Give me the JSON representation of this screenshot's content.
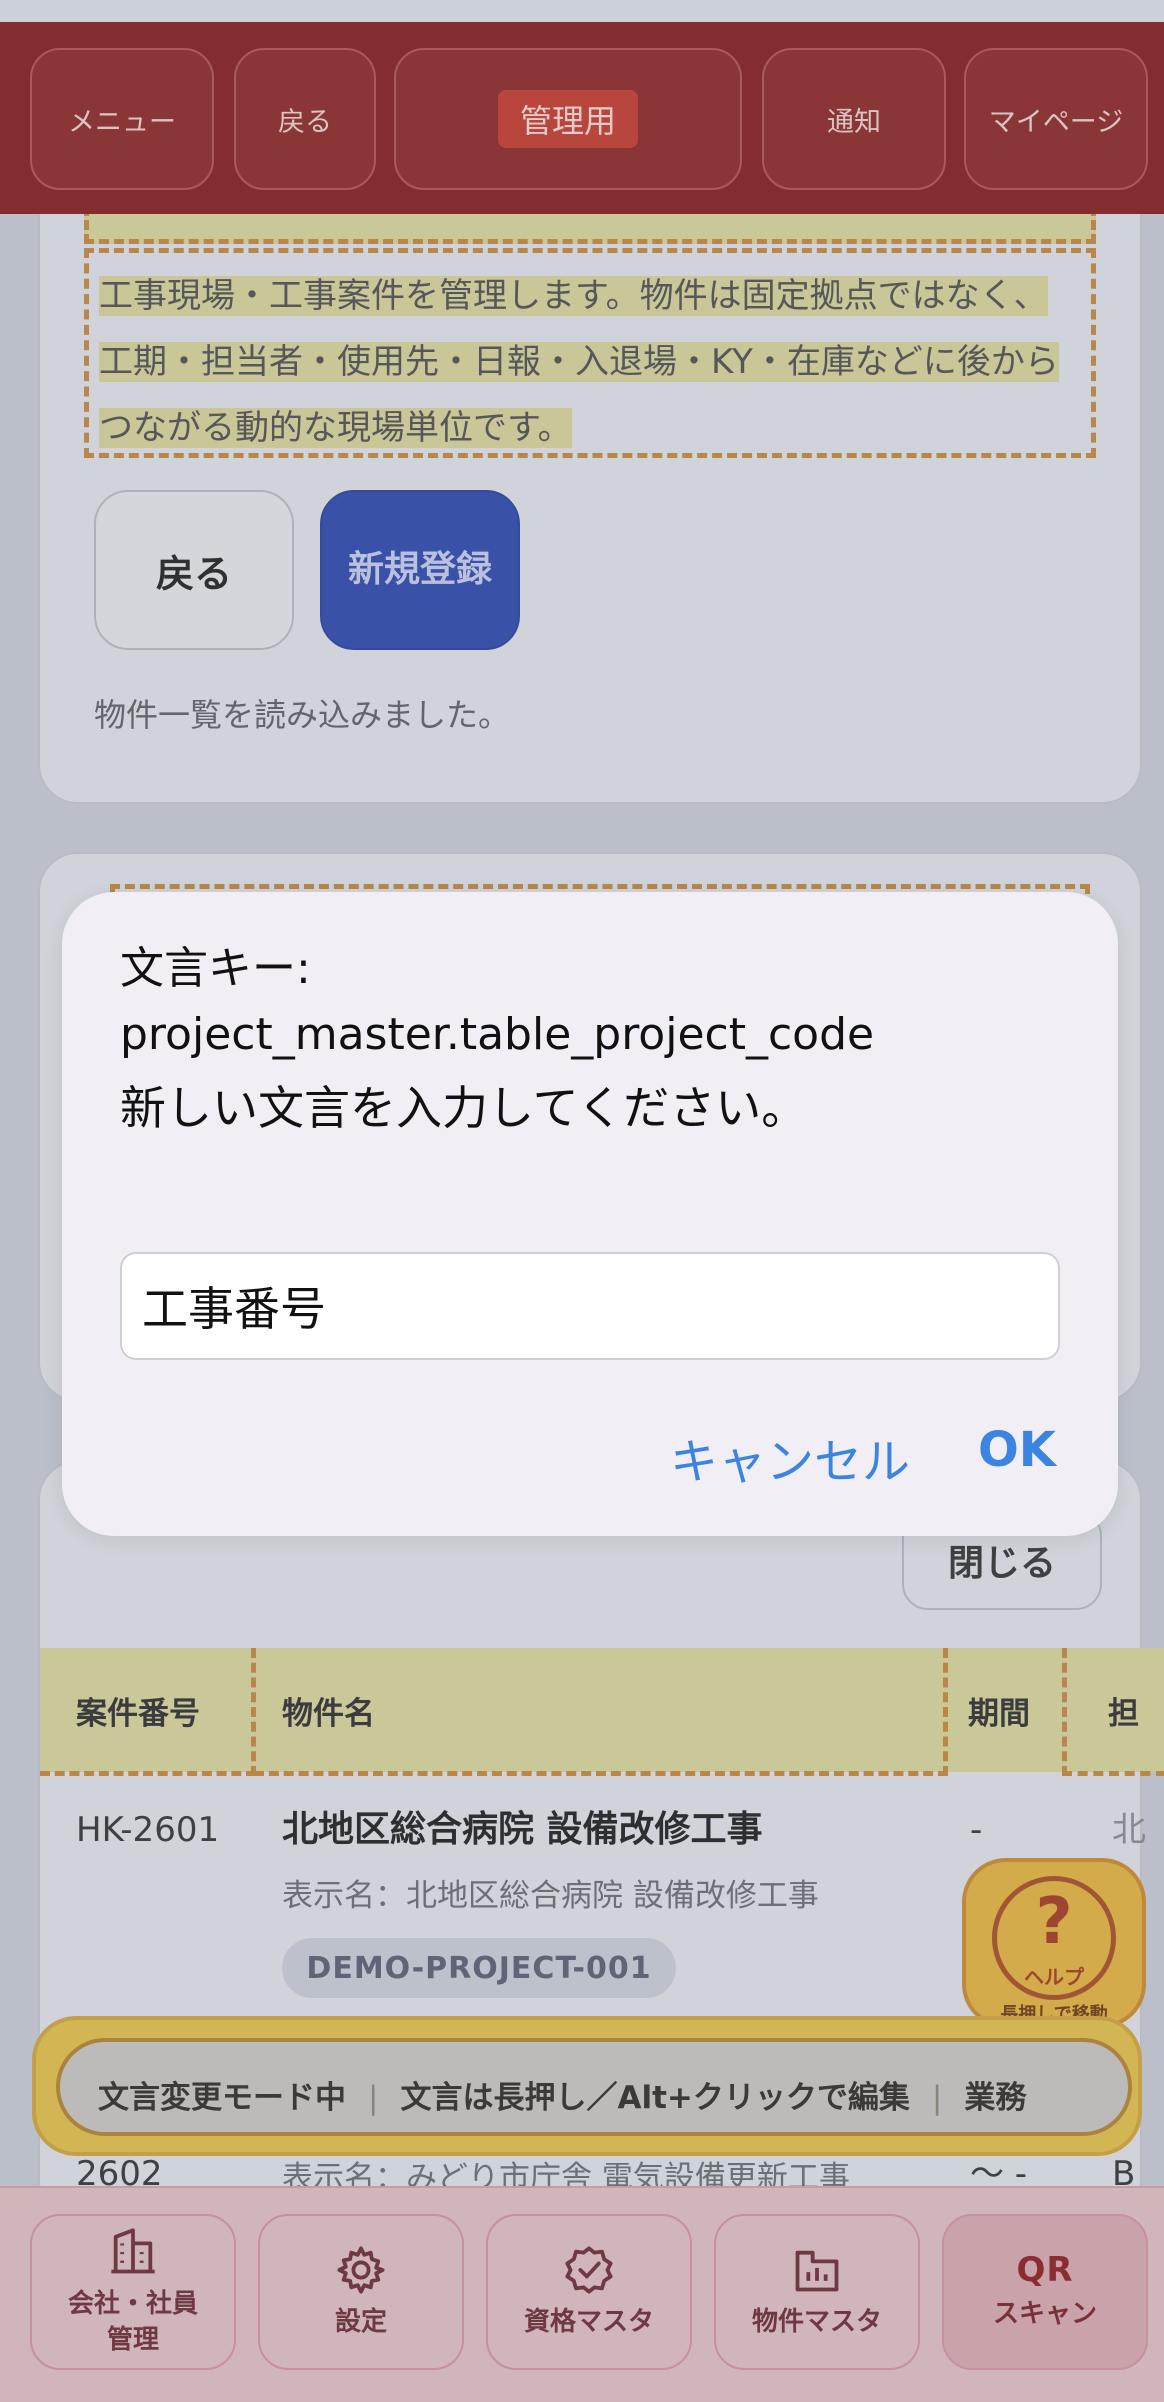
{
  "header": {
    "menu_label": "メニュー",
    "back_label": "戻る",
    "admin_label": "管理用",
    "notify_label": "通知",
    "mypage_label": "マイページ"
  },
  "intro": {
    "description": "工事現場・工事案件を管理します。物件は固定拠点ではなく、工期・担当者・使用先・日報・入退場・KY・在庫などに後からつながる動的な現場単位です。",
    "back_button": "戻る",
    "new_button": "新規登録",
    "status": "物件一覧を読み込みました。"
  },
  "list": {
    "close_button": "閉じる",
    "columns": [
      "案件番号",
      "物件名",
      "期間",
      "担"
    ],
    "rows": [
      {
        "code": "HK-2601",
        "name": "北地区総合病院 設備改修工事",
        "display_name": "表示名：北地区総合病院 設備改修工事",
        "badge": "DEMO-PROJECT-001",
        "period": "-",
        "owner": "北"
      },
      {
        "code": "2602",
        "display_name": "表示名：みどり市庁舎 電気設備更新工事",
        "period": "〜 -",
        "owner": "B"
      }
    ]
  },
  "help": {
    "label": "ヘルプ",
    "sub": "長押しで移動"
  },
  "mode_banner": {
    "mode": "文言変更モード中",
    "hint": "文言は長押し／Alt+クリックで編集",
    "trail": "業務"
  },
  "bottom_nav": {
    "company": "会社・社員管理",
    "settings": "設定",
    "qualification": "資格マスタ",
    "project": "物件マスタ",
    "qr_title": "QR",
    "qr_label": "スキャン"
  },
  "dialog": {
    "message_key_label": "文言キー:",
    "message_key": "project_master.table_project_code",
    "prompt": "新しい文言を入力してください。",
    "input_value": "工事番号",
    "cancel": "キャンセル",
    "ok": "OK"
  },
  "colors": {
    "header_bg": "#861b1b",
    "accent_blue": "#2b47ac",
    "highlight": "#dcd79c",
    "dashed_border": "#c7893b",
    "dialog_link": "#3b84e0"
  }
}
